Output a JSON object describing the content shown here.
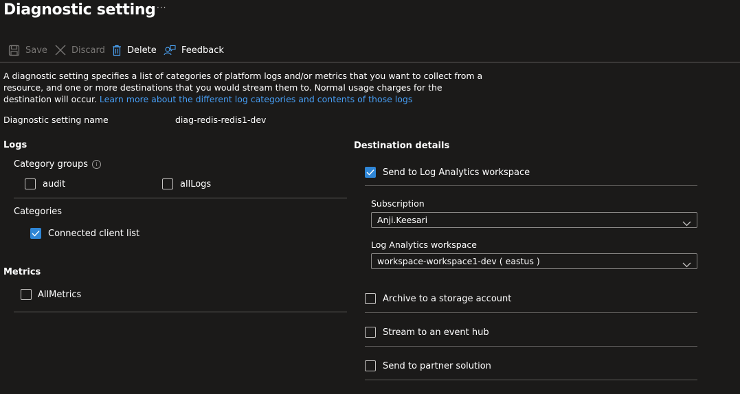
{
  "page": {
    "title": "Diagnostic setting",
    "more_label": "···"
  },
  "toolbar": {
    "save_label": "Save",
    "discard_label": "Discard",
    "delete_label": "Delete",
    "feedback_label": "Feedback"
  },
  "description": {
    "text": "A diagnostic setting specifies a list of categories of platform logs and/or metrics that you want to collect from a resource, and one or more destinations that you would stream them to. Normal usage charges for the destination will occur. ",
    "link_text": "Learn more about the different log categories and contents of those logs"
  },
  "setting_name": {
    "label": "Diagnostic setting name",
    "value": "diag-redis-redis1-dev"
  },
  "logs": {
    "heading": "Logs",
    "category_groups_label": "Category groups",
    "category_groups": [
      {
        "label": "audit",
        "checked": false
      },
      {
        "label": "allLogs",
        "checked": false
      }
    ],
    "categories_label": "Categories",
    "categories": [
      {
        "label": "Connected client list",
        "checked": true
      }
    ]
  },
  "metrics": {
    "heading": "Metrics",
    "items": [
      {
        "label": "AllMetrics",
        "checked": false
      }
    ]
  },
  "destination": {
    "heading": "Destination details",
    "log_analytics": {
      "label": "Send to Log Analytics workspace",
      "checked": true
    },
    "subscription_label": "Subscription",
    "subscription_value": "Anji.Keesari",
    "workspace_label": "Log Analytics workspace",
    "workspace_value": "workspace-workspace1-dev ( eastus )",
    "archive": {
      "label": "Archive to a storage account",
      "checked": false
    },
    "event_hub": {
      "label": "Stream to an event hub",
      "checked": false
    },
    "partner": {
      "label": "Send to partner solution",
      "checked": false
    }
  },
  "colors": {
    "background": "#1b1a19",
    "accent": "#2f86d6",
    "link": "#479ef5",
    "divider": "#605e5c"
  }
}
